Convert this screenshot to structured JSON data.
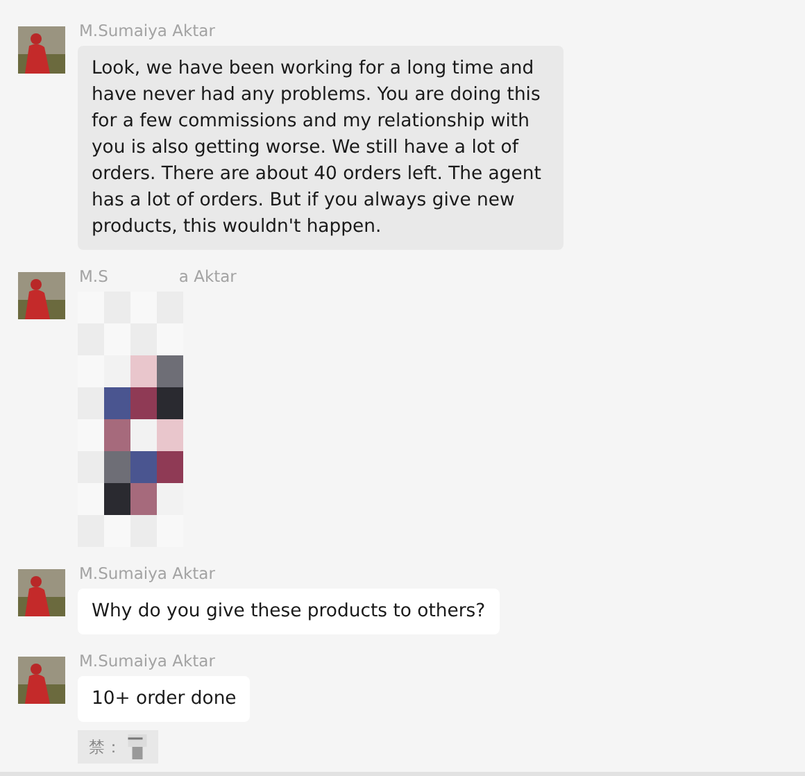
{
  "messages": [
    {
      "kind": "text",
      "name_parts": [
        "M.Sumaiya Aktar"
      ],
      "text": " Look, we have been working for a long time and have never had any problems. You are doing this for a few commissions and my relationship with you is also getting worse. We still have a lot of orders. There are about 40 orders left. The agent has a lot of orders. But if you always give new products, this wouldn't happen.",
      "highlighted": true
    },
    {
      "name_parts": [
        "M.S",
        "a Aktar"
      ]
    },
    {
      "kind": "text",
      "name_parts": [
        "M.Sumaiya Aktar"
      ],
      "text": "Why do you give these products to others?",
      "highlighted": false
    },
    {
      "kind": "text",
      "name_parts": [
        "M.Sumaiya Aktar"
      ],
      "text": "10+ order done",
      "highlighted": false,
      "quote": {
        "text": "禁："
      }
    }
  ]
}
